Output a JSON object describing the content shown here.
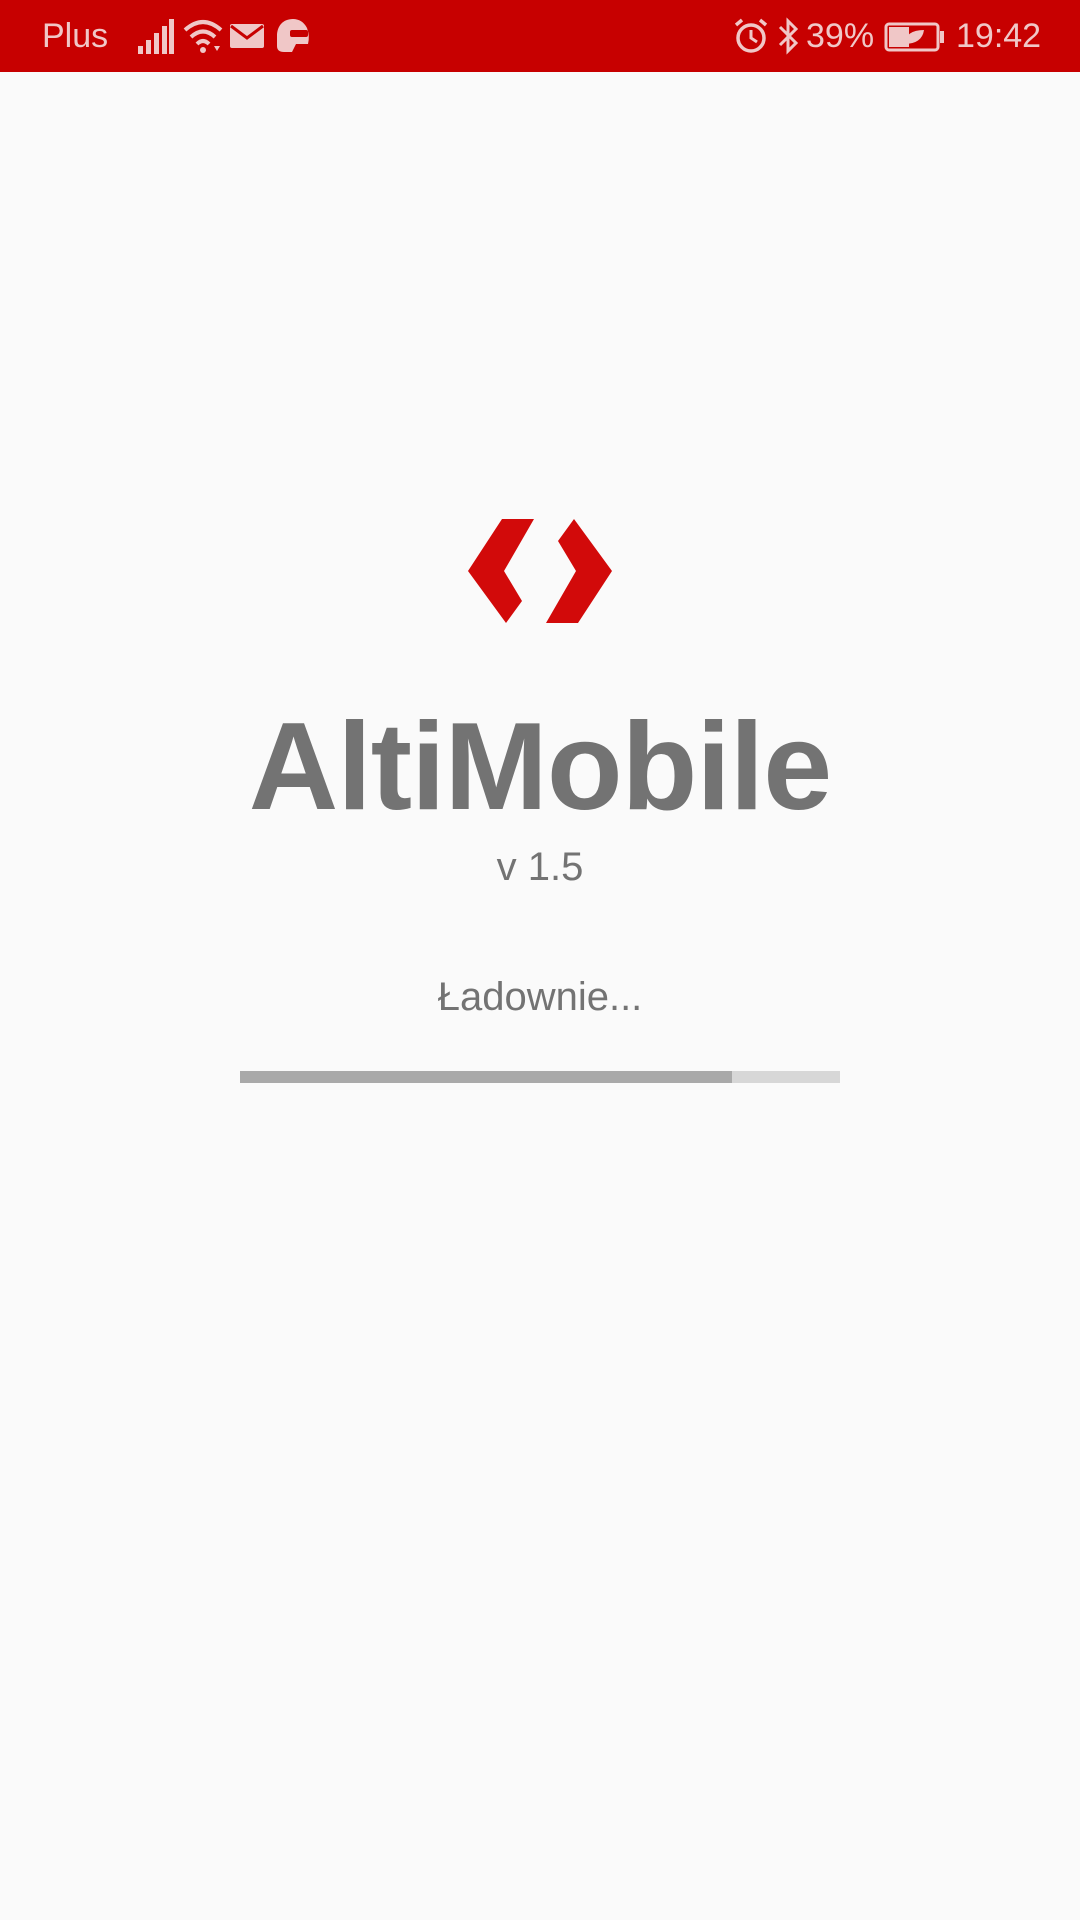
{
  "status_bar": {
    "carrier": "Plus",
    "battery_percent": "39%",
    "time": "19:42",
    "background_color": "#c70000",
    "icons": [
      "signal-icon",
      "wifi-icon",
      "mail-icon",
      "helmet-app-icon",
      "alarm-icon",
      "bluetooth-icon",
      "battery-saver-icon"
    ]
  },
  "splash": {
    "app_name": "AltiMobile",
    "version": "v 1.5",
    "loading_text": "Ładownie...",
    "progress": 0.82,
    "logo_color": "#d20a0a",
    "text_color": "#737373"
  }
}
